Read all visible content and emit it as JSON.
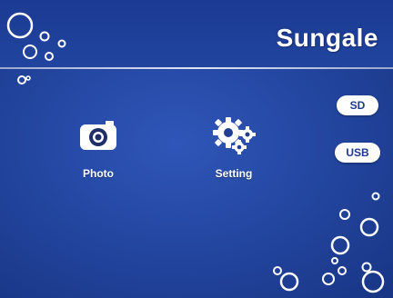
{
  "header": {
    "brand_logo": "Sungale"
  },
  "menu": {
    "items": [
      {
        "label": "Photo",
        "icon": "camera-icon"
      },
      {
        "label": "Setting",
        "icon": "gears-icon"
      }
    ]
  },
  "storage": {
    "sd_label": "SD",
    "usb_label": "USB"
  },
  "colors": {
    "background": "#2447a2",
    "header_background": "#1b3a93",
    "accent": "#ffffff",
    "pill_text": "#1c3a8e"
  }
}
